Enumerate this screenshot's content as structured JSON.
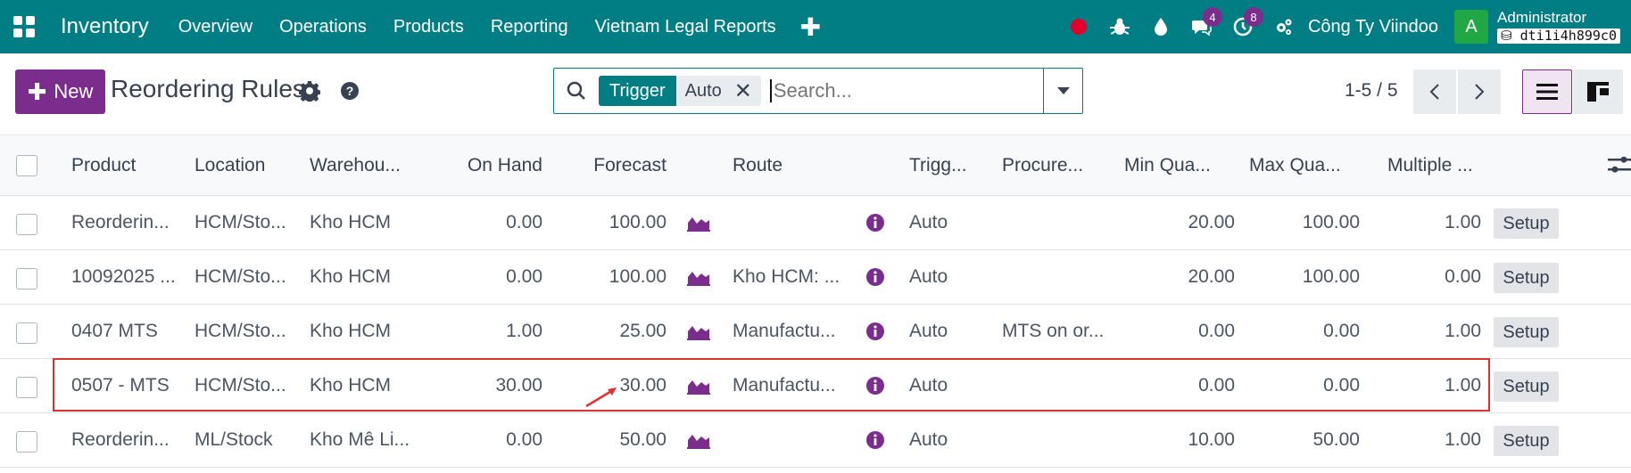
{
  "navbar": {
    "app_name": "Inventory",
    "menu": [
      "Overview",
      "Operations",
      "Products",
      "Reporting",
      "Vietnam Legal Reports"
    ],
    "plus_label": "✚",
    "messages_count": "4",
    "activities_count": "8",
    "company": "Công Ty Viindoo",
    "avatar_letter": "A",
    "user_name": "Administrator",
    "db_name": "dti1i4h899c0",
    "bg_color": "#017e84"
  },
  "control": {
    "new_label": "New",
    "title": "Reordering Rules",
    "facet_label": "Trigger",
    "facet_value": "Auto",
    "search_placeholder": "Search...",
    "pager": "1-5 / 5",
    "accent_color": "#7b2d8e"
  },
  "table": {
    "columns": [
      "Product",
      "Location",
      "Warehou...",
      "On Hand",
      "Forecast",
      "Route",
      "Trigg...",
      "Procure...",
      "Min Qua...",
      "Max Qua...",
      "Multiple ..."
    ],
    "setup_label": "Setup",
    "rows": [
      {
        "product": "Reorderin...",
        "location": "HCM/Sto...",
        "warehouse": "Kho HCM",
        "on_hand": "0.00",
        "forecast": "100.00",
        "route": "",
        "trigger": "Auto",
        "procure": "",
        "min": "20.00",
        "max": "100.00",
        "multiple": "1.00"
      },
      {
        "product": "10092025 ...",
        "location": "HCM/Sto...",
        "warehouse": "Kho HCM",
        "on_hand": "0.00",
        "forecast": "100.00",
        "route": "Kho HCM: ...",
        "trigger": "Auto",
        "procure": "",
        "min": "20.00",
        "max": "100.00",
        "multiple": "0.00"
      },
      {
        "product": "0407 MTS",
        "location": "HCM/Sto...",
        "warehouse": "Kho HCM",
        "on_hand": "1.00",
        "forecast": "25.00",
        "route": "Manufactu...",
        "trigger": "Auto",
        "procure": "MTS on or...",
        "min": "0.00",
        "max": "0.00",
        "multiple": "1.00"
      },
      {
        "product": "0507 - MTS",
        "location": "HCM/Sto...",
        "warehouse": "Kho HCM",
        "on_hand": "30.00",
        "forecast": "30.00",
        "route": "Manufactu...",
        "trigger": "Auto",
        "procure": "",
        "min": "0.00",
        "max": "0.00",
        "multiple": "1.00"
      },
      {
        "product": "Reorderin...",
        "location": "ML/Stock",
        "warehouse": "Kho Mê Li...",
        "on_hand": "0.00",
        "forecast": "50.00",
        "route": "",
        "trigger": "Auto",
        "procure": "",
        "min": "10.00",
        "max": "50.00",
        "multiple": "1.00"
      }
    ]
  }
}
